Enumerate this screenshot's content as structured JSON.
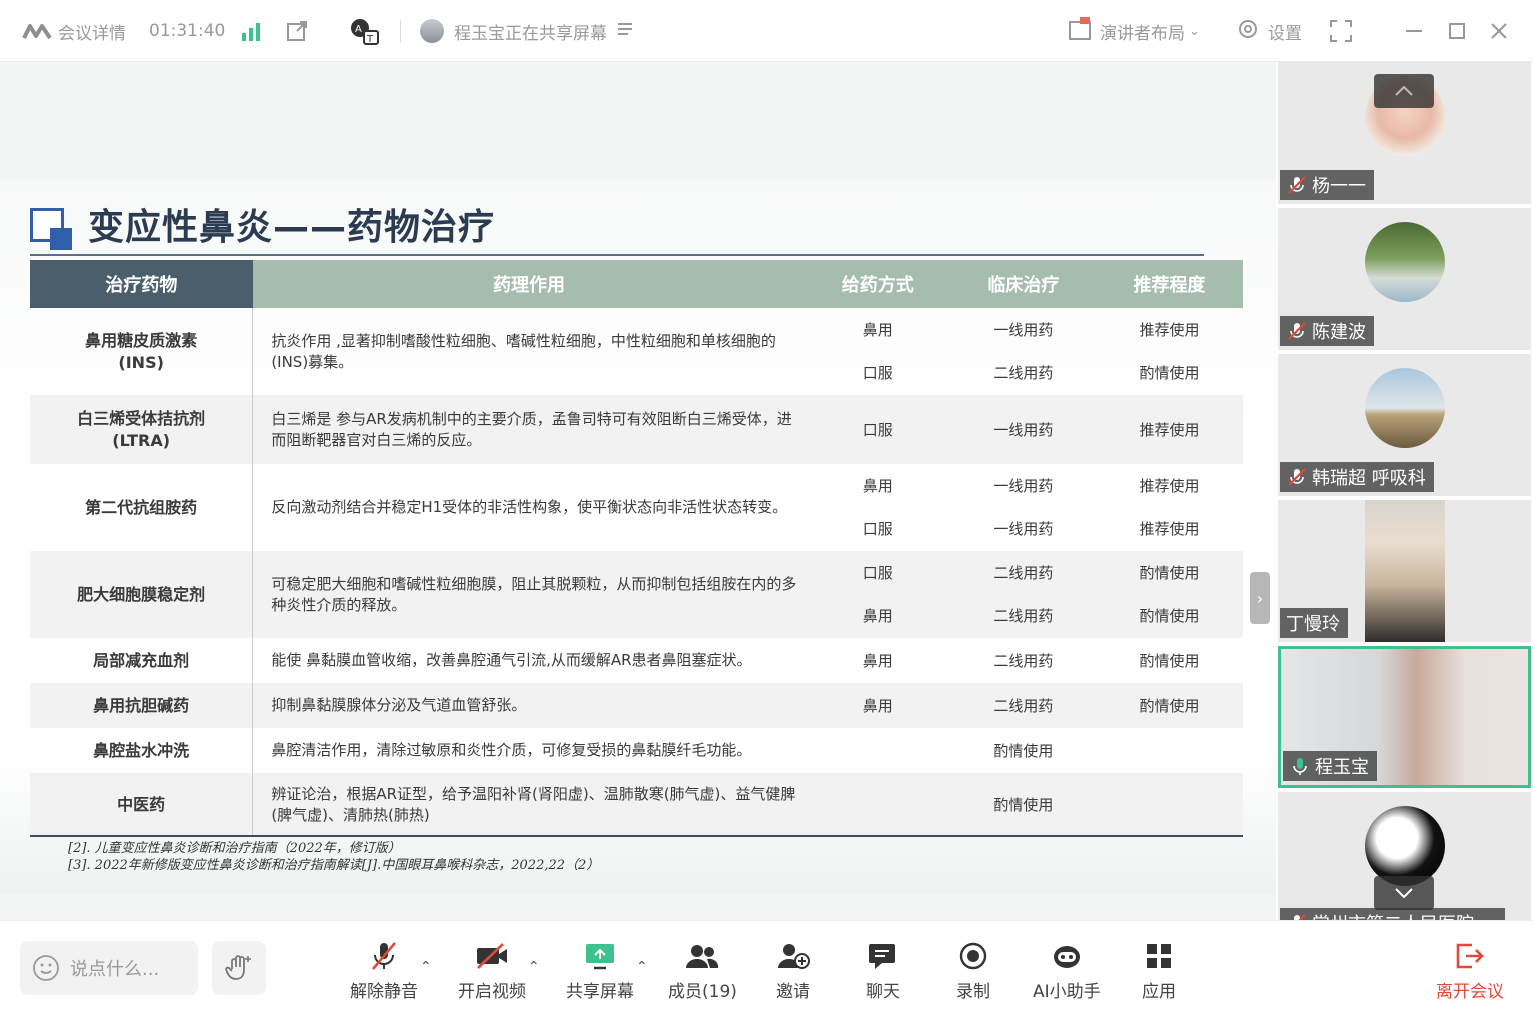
{
  "topbar": {
    "meeting_info": "会议详情",
    "timer": "01:31:40",
    "sharing_status": "程玉宝正在共享屏幕",
    "layout": "演讲者布局",
    "settings": "设置"
  },
  "slide": {
    "title": "变应性鼻炎——药物治疗",
    "headers": [
      "治疗药物",
      "药理作用",
      "给药方式",
      "临床治疗",
      "推荐程度"
    ],
    "rows": [
      {
        "name": "鼻用糖皮质激素",
        "name2": "(INS)",
        "desc": "抗炎作用 ,显著抑制嗜酸性粒细胞、嗜碱性粒细胞，中性粒细胞和单核细胞的(INS)募集。",
        "routes": [
          "鼻用",
          "口服"
        ],
        "lines": [
          "一线用药",
          "二线用药"
        ],
        "recs": [
          "推荐使用",
          "酌情使用"
        ]
      },
      {
        "name": "白三烯受体拮抗剂",
        "name2": "(LTRA)",
        "desc": "白三烯是 参与AR发病机制中的主要介质，孟鲁司特可有效阻断白三烯受体，进而阻断靶器官对白三烯的反应。",
        "routes": [
          "口服"
        ],
        "lines": [
          "一线用药"
        ],
        "recs": [
          "推荐使用"
        ]
      },
      {
        "name": "第二代抗组胺药",
        "name2": "",
        "desc": "反向激动剂结合并稳定H1受体的非活性构象，使平衡状态向非活性状态转变。",
        "routes": [
          "鼻用",
          "口服"
        ],
        "lines": [
          "一线用药",
          "一线用药"
        ],
        "recs": [
          "推荐使用",
          "推荐使用"
        ]
      },
      {
        "name": "肥大细胞膜稳定剂",
        "name2": "",
        "desc": "可稳定肥大细胞和嗜碱性粒细胞膜，阻止其脱颗粒，从而抑制包括组胺在内的多种炎性介质的释放。",
        "routes": [
          "口服",
          "鼻用"
        ],
        "lines": [
          "二线用药",
          "二线用药"
        ],
        "recs": [
          "酌情使用",
          "酌情使用"
        ]
      },
      {
        "name": "局部减充血剂",
        "name2": "",
        "desc": "能使 鼻黏膜血管收缩，改善鼻腔通气引流,从而缓解AR患者鼻阻塞症状。",
        "routes": [
          "鼻用"
        ],
        "lines": [
          "二线用药"
        ],
        "recs": [
          "酌情使用"
        ]
      },
      {
        "name": "鼻用抗胆碱药",
        "name2": "",
        "desc": "抑制鼻黏膜腺体分泌及气道血管舒张。",
        "routes": [
          "鼻用"
        ],
        "lines": [
          "二线用药"
        ],
        "recs": [
          "酌情使用"
        ]
      },
      {
        "name": "鼻腔盐水冲洗",
        "name2": "",
        "desc": "鼻腔清洁作用，清除过敏原和炎性介质，可修复受损的鼻黏膜纤毛功能。",
        "routes": [
          ""
        ],
        "lines": [
          "酌情使用"
        ],
        "recs": [
          ""
        ]
      },
      {
        "name": "中医药",
        "name2": "",
        "desc": "辨证论治，根据AR证型，给予温阳补肾(肾阳虚)、温肺散寒(肺气虚)、益气健脾(脾气虚)、清肺热(肺热)",
        "routes": [
          ""
        ],
        "lines": [
          "酌情使用"
        ],
        "recs": [
          ""
        ]
      }
    ],
    "refs": [
      "[2]. 儿童变应性鼻炎诊断和治疗指南（2022年，修订版）",
      "[3]. 2022年新修版变应性鼻炎诊断和治疗指南解读[J].中国眼耳鼻喉科杂志，2022,22（2）"
    ]
  },
  "participants": [
    {
      "name": "杨一一",
      "muted": true
    },
    {
      "name": "陈建波",
      "muted": true
    },
    {
      "name": "韩瑞超 呼吸科",
      "muted": true
    },
    {
      "name": "丁慢玲",
      "muted": false
    },
    {
      "name": "程玉宝",
      "muted": false
    },
    {
      "name": "常州市第二人民医院 ...",
      "muted": true
    }
  ],
  "bottombar": {
    "chat_placeholder": "说点什么...",
    "unmute": "解除静音",
    "video": "开启视频",
    "share": "共享屏幕",
    "members": "成员(19)",
    "invite": "邀请",
    "chat": "聊天",
    "record": "录制",
    "ai": "AI小助手",
    "apps": "应用",
    "leave": "离开会议"
  },
  "colors": {
    "accent_green": "#3cc28a",
    "leave_red": "#e04a3a",
    "table_header_dark": "#4a5f6b",
    "table_header_light": "#a6bcae"
  }
}
